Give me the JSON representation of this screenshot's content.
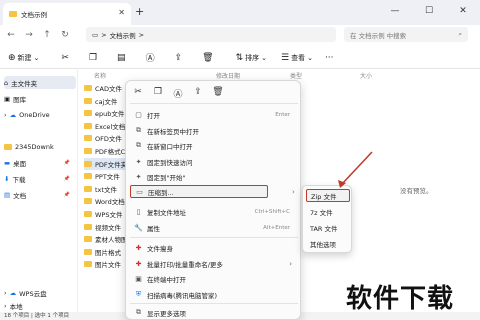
{
  "window": {
    "tab_title": "文档示例",
    "close_glyph": "✕",
    "newtab_glyph": "+",
    "controls": [
      "—",
      "☐",
      "✕"
    ]
  },
  "address": {
    "breadcrumb_sep": ">",
    "folder": "文档示例",
    "search_placeholder": "在 文档示例 中搜索"
  },
  "toolbar": {
    "new_label": "新建",
    "sort_label": "排序",
    "view_label": "查看"
  },
  "sidebar": {
    "items": [
      {
        "label": "主文件夹"
      },
      {
        "label": "图库"
      },
      {
        "label": "OneDrive"
      },
      {
        "label": "2345Downk"
      },
      {
        "label": "桌面"
      },
      {
        "label": "下载"
      },
      {
        "label": "文档"
      },
      {
        "label": "WPS云盘"
      },
      {
        "label": "本地"
      }
    ]
  },
  "filelist": {
    "col_name": "名称",
    "col_date": "修改日期",
    "col_type": "类型",
    "col_size": "大小",
    "files": [
      "CAD文件",
      "caj文件",
      "epub文件",
      "Excel文档",
      "OFD文件",
      "PDF格式CA",
      "PDF文件夹",
      "PPT文件",
      "txt文件",
      "Word文档",
      "WPS文件",
      "视频文件",
      "素材人物图",
      "图片格式",
      "图片文件"
    ],
    "empty_text": "没有预览。"
  },
  "status": {
    "text": "18 个项目  |  选中 1 个项目"
  },
  "context_menu": {
    "open": "打开",
    "open_enter": "Enter",
    "open_new_tab": "在新标签页中打开",
    "open_new_window": "在新窗口中打开",
    "pin_quick": "固定到快速访问",
    "pin_start": "固定到\"开始\"",
    "compress": "压缩到...",
    "copy_path": "复制文件地址",
    "copy_path_sc": "Ctrl+Shift+C",
    "properties": "属性",
    "properties_sc": "Alt+Enter",
    "slim": "文件瘦身",
    "batch": "批量打印/批量重命名/更多",
    "terminal": "在终端中打开",
    "scan": "扫描病毒(腾讯电脑管家)",
    "more": "显示更多选项"
  },
  "submenu": {
    "items": [
      "Zip 文件",
      "7z 文件",
      "TAR 文件",
      "其他选项"
    ]
  },
  "watermark": "软件下载",
  "colors": {
    "highlight": "#c0392b",
    "accent": "#1a73e8"
  }
}
